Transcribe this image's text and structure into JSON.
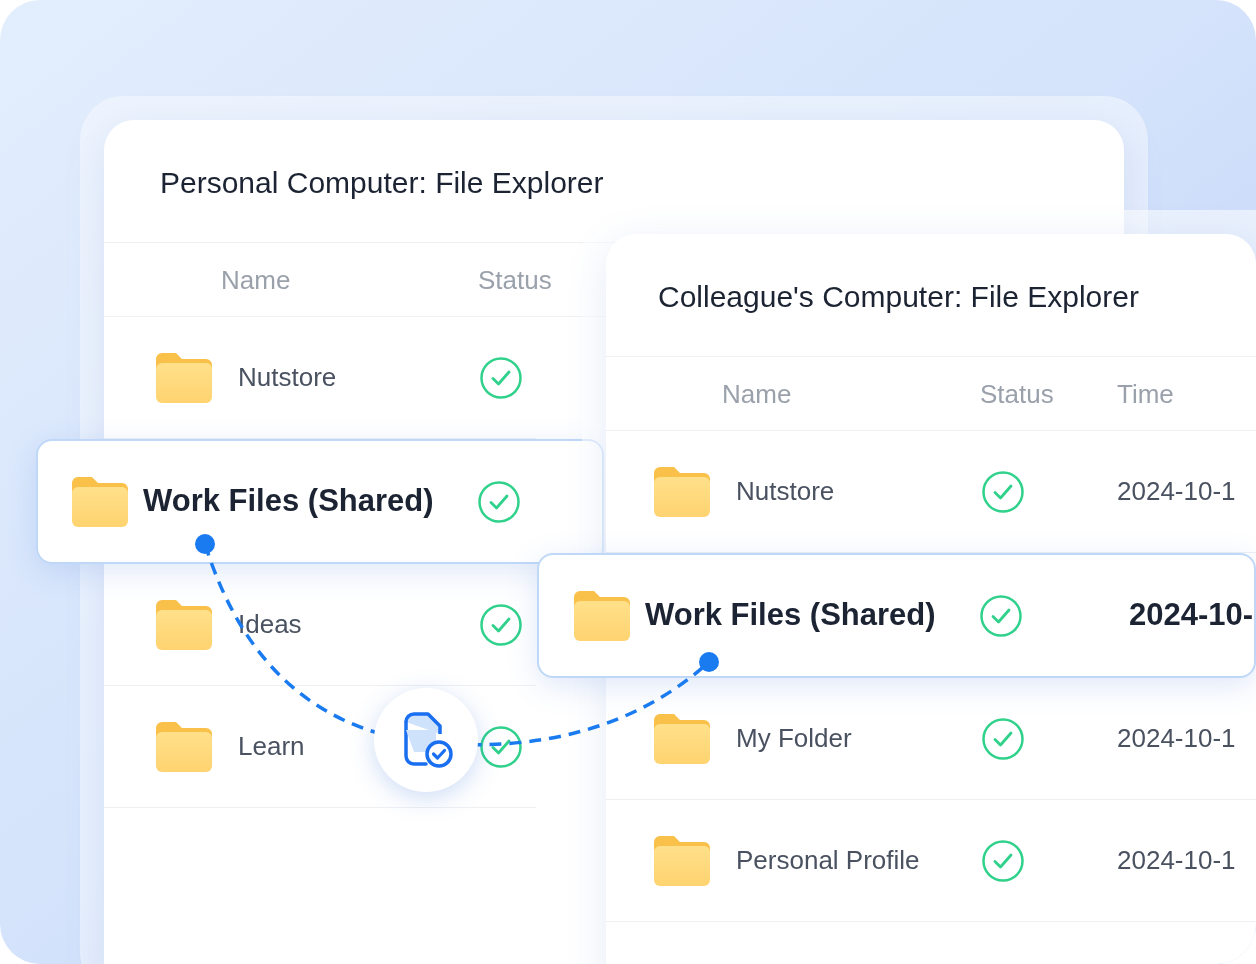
{
  "windows": [
    {
      "title": "Personal Computer: File Explorer",
      "columns": [
        "Name",
        "Status"
      ],
      "rows": [
        {
          "name": "Nutstore",
          "synced": true,
          "selected": false
        },
        {
          "name": "Work Files (Shared)",
          "synced": true,
          "selected": true
        },
        {
          "name": "Ideas",
          "synced": true,
          "selected": false
        },
        {
          "name": "Learn",
          "synced": true,
          "selected": false
        }
      ]
    },
    {
      "title": "Colleague's Computer: File Explorer",
      "columns": [
        "Name",
        "Status",
        "Time"
      ],
      "rows": [
        {
          "name": "Nutstore",
          "synced": true,
          "selected": false,
          "time": "2024-10-1"
        },
        {
          "name": "Work Files (Shared)",
          "synced": true,
          "selected": true,
          "time": "2024-10-"
        },
        {
          "name": "My Folder",
          "synced": true,
          "selected": false,
          "time": "2024-10-1"
        },
        {
          "name": "Personal Profile",
          "synced": true,
          "selected": false,
          "time": "2024-10-1"
        }
      ]
    }
  ]
}
